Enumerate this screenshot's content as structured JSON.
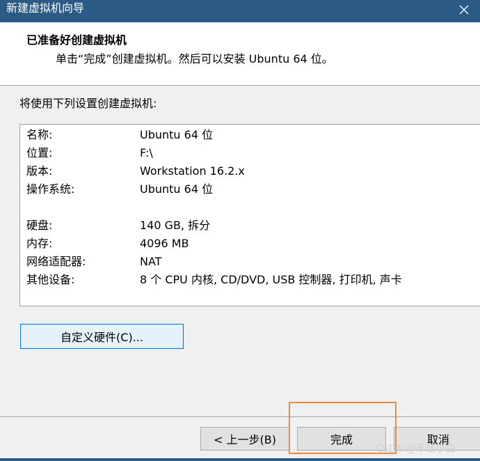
{
  "window": {
    "title": "新建虚拟机向导"
  },
  "header": {
    "title": "已准备好创建虚拟机",
    "subtitle": "单击“完成”创建虚拟机。然后可以安装 Ubuntu 64 位。"
  },
  "intro_text": "将使用下列设置创建虚拟机:",
  "summary": [
    {
      "label": "名称:",
      "value": "Ubuntu 64 位"
    },
    {
      "label": "位置:",
      "value": "F:\\"
    },
    {
      "label": "版本:",
      "value": "Workstation 16.2.x"
    },
    {
      "label": "操作系统:",
      "value": "Ubuntu 64 位"
    },
    {
      "label": "硬盘:",
      "value": "140 GB, 拆分"
    },
    {
      "label": "内存:",
      "value": "4096 MB"
    },
    {
      "label": "网络适配器:",
      "value": "NAT"
    },
    {
      "label": "其他设备:",
      "value": "8 个 CPU 内核, CD/DVD, USB 控制器, 打印机, 声卡"
    }
  ],
  "buttons": {
    "customize": "自定义硬件(C)...",
    "back": "< 上一步(B)",
    "finish": "完成",
    "cancel": "取消"
  },
  "watermark": "CSDN @千饭小白",
  "colors": {
    "titlebar": "#2b5b84",
    "highlight": "#f0883a",
    "focus_border": "#0078d7"
  },
  "icons": {
    "close": "close-icon"
  }
}
